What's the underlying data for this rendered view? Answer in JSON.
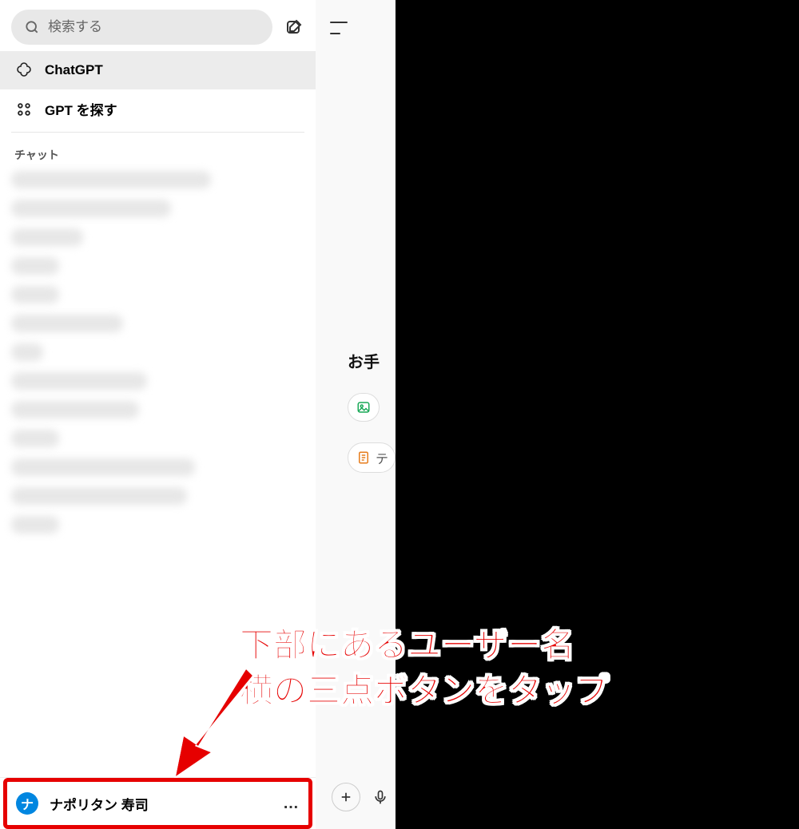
{
  "sidebar": {
    "search_placeholder": "検索する",
    "nav": {
      "chatgpt_label": "ChatGPT",
      "explore_label": "GPT を探す"
    },
    "section_label": "チャット",
    "blur_widths": [
      250,
      200,
      90,
      60,
      60,
      140,
      40,
      170,
      160,
      60,
      230,
      220,
      60
    ],
    "user": {
      "avatar_initial": "ナ",
      "name": "ナポリタン 寿司",
      "dots_label": "…"
    }
  },
  "main": {
    "headline_fragment": "お手",
    "chip2_fragment": "テ"
  },
  "annotation": {
    "line1": "下部にあるユーザー名",
    "line2": "横の三点ボタンをタップ"
  },
  "colors": {
    "highlight": "#e60000",
    "avatar_bg": "#0086e0"
  }
}
